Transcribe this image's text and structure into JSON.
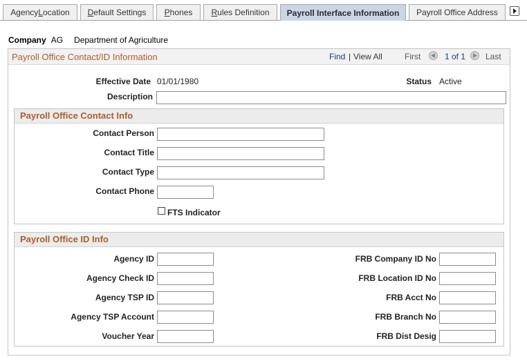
{
  "tabs": [
    {
      "pre": "Agency ",
      "u": "L",
      "post": "ocation",
      "active": false
    },
    {
      "pre": "",
      "u": "D",
      "post": "efault Settings",
      "active": false
    },
    {
      "pre": "",
      "u": "P",
      "post": "hones",
      "active": false
    },
    {
      "pre": "",
      "u": "R",
      "post": "ules Definition",
      "active": false
    },
    {
      "pre": "Payroll Interface Information",
      "u": "",
      "post": "",
      "active": true
    },
    {
      "pre": "Payroll Office Address",
      "u": "",
      "post": "",
      "active": false
    }
  ],
  "tab_scroll_icon": "triangle-right-icon",
  "company": {
    "label": "Company",
    "code": "AG",
    "description": "Department of Agriculture"
  },
  "section": {
    "title": "Payroll Office Contact/ID Information",
    "find": "Find",
    "separator": "|",
    "view_all": "View All",
    "first": "First",
    "count": "1 of 1",
    "last": "Last"
  },
  "effective_date": {
    "label": "Effective Date",
    "value": "01/01/1980"
  },
  "status": {
    "label": "Status",
    "value": "Active"
  },
  "description": {
    "label": "Description",
    "value": ""
  },
  "contact_group": {
    "title": "Payroll Office Contact Info",
    "contact_person": {
      "label": "Contact Person",
      "value": ""
    },
    "contact_title": {
      "label": "Contact Title",
      "value": ""
    },
    "contact_type": {
      "label": "Contact Type",
      "value": ""
    },
    "contact_phone": {
      "label": "Contact Phone",
      "value": ""
    },
    "fts_indicator": {
      "label": "FTS Indicator",
      "checked": false
    }
  },
  "id_group": {
    "title": "Payroll Office ID Info",
    "left": [
      {
        "label": "Agency ID",
        "value": ""
      },
      {
        "label": "Agency Check ID",
        "value": ""
      },
      {
        "label": "Agency TSP ID",
        "value": ""
      },
      {
        "label": "Agency TSP Account",
        "value": ""
      },
      {
        "label": "Voucher Year",
        "value": ""
      }
    ],
    "right": [
      {
        "label": "FRB Company ID No",
        "value": ""
      },
      {
        "label": "FRB Location ID No",
        "value": ""
      },
      {
        "label": "FRB Acct No",
        "value": ""
      },
      {
        "label": "FRB Branch No",
        "value": ""
      },
      {
        "label": "FRB Dist Desig",
        "value": ""
      }
    ]
  },
  "colors": {
    "section_title": "#ae5c2c",
    "active_tab": "#c9d6e6",
    "link": "#0b3d91"
  }
}
